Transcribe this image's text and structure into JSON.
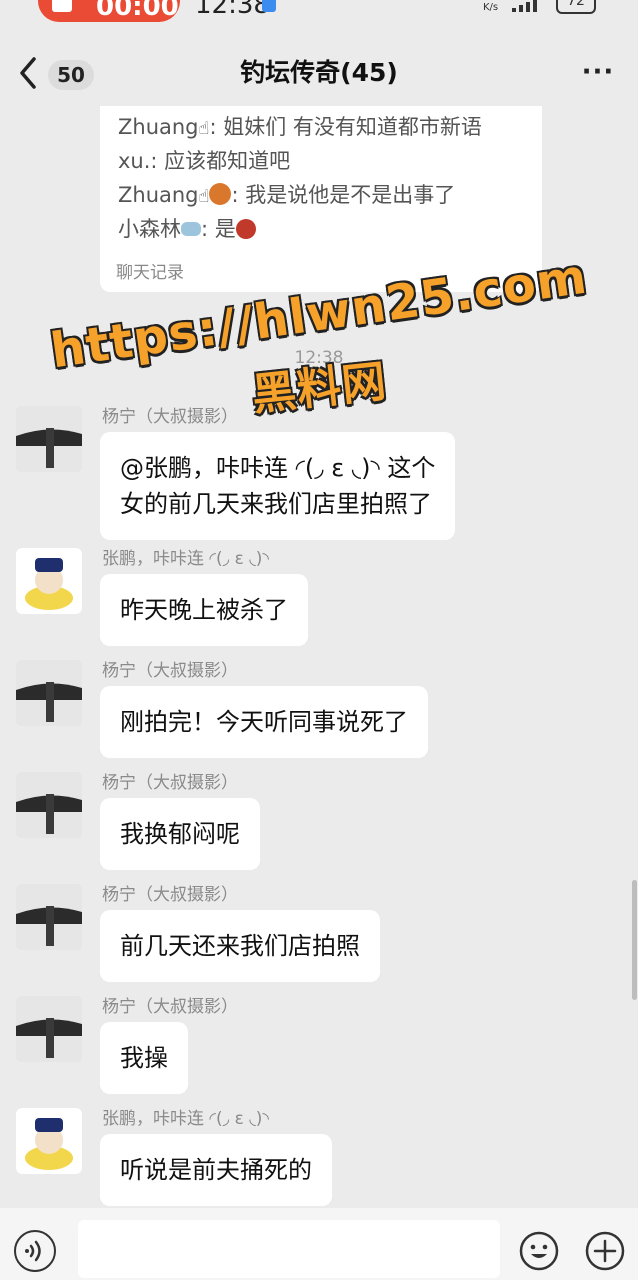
{
  "status_bar": {
    "record_time": "00:00",
    "time": "12:38",
    "net_unit": "K/s",
    "battery": "72"
  },
  "header": {
    "unread_count": "50",
    "title": "钓坛传奇(45)",
    "more_glyph": "···"
  },
  "chat_record": {
    "lines": [
      {
        "name": "Zhuang",
        "text": ": 姐妹们 有没有知道都市新语"
      },
      {
        "name": "xu.",
        "text": ": 应该都知道吧"
      },
      {
        "name": "Zhuang",
        "text": ": 我是说他是不是出事了"
      },
      {
        "name": "小森林",
        "text": ": 是"
      }
    ],
    "footer": "聊天记录"
  },
  "time_mark": "12:38",
  "messages": [
    {
      "sender": "杨宁（大叔摄影）",
      "text": "@张鹏，咔咔连 ◜(◞ ε ◟)◝ 这个\n女的前几天来我们店里拍照了",
      "avatar": "landscape"
    },
    {
      "sender": "张鹏，咔咔连 ◜(◞ ε ◟)◝",
      "text": "昨天晚上被杀了",
      "avatar": "cartoon"
    },
    {
      "sender": "杨宁（大叔摄影）",
      "text": "刚拍完！今天听同事说死了",
      "avatar": "landscape"
    },
    {
      "sender": "杨宁（大叔摄影）",
      "text": "我换郁闷呢",
      "avatar": "landscape"
    },
    {
      "sender": "杨宁（大叔摄影）",
      "text": "前几天还来我们店拍照",
      "avatar": "landscape"
    },
    {
      "sender": "杨宁（大叔摄影）",
      "text": "我操",
      "avatar": "landscape"
    },
    {
      "sender": "张鹏，咔咔连 ◜(◞ ε ◟)◝",
      "text": "听说是前夫捅死的",
      "avatar": "cartoon"
    }
  ],
  "watermark": {
    "url": "https://hlwn25.com",
    "name": "黑料网"
  },
  "input_bar": {
    "placeholder": ""
  },
  "colors": {
    "background": "#ebebeb",
    "bubble": "#ffffff",
    "record_button": "#e94b35",
    "watermark": "#f6a22a"
  }
}
